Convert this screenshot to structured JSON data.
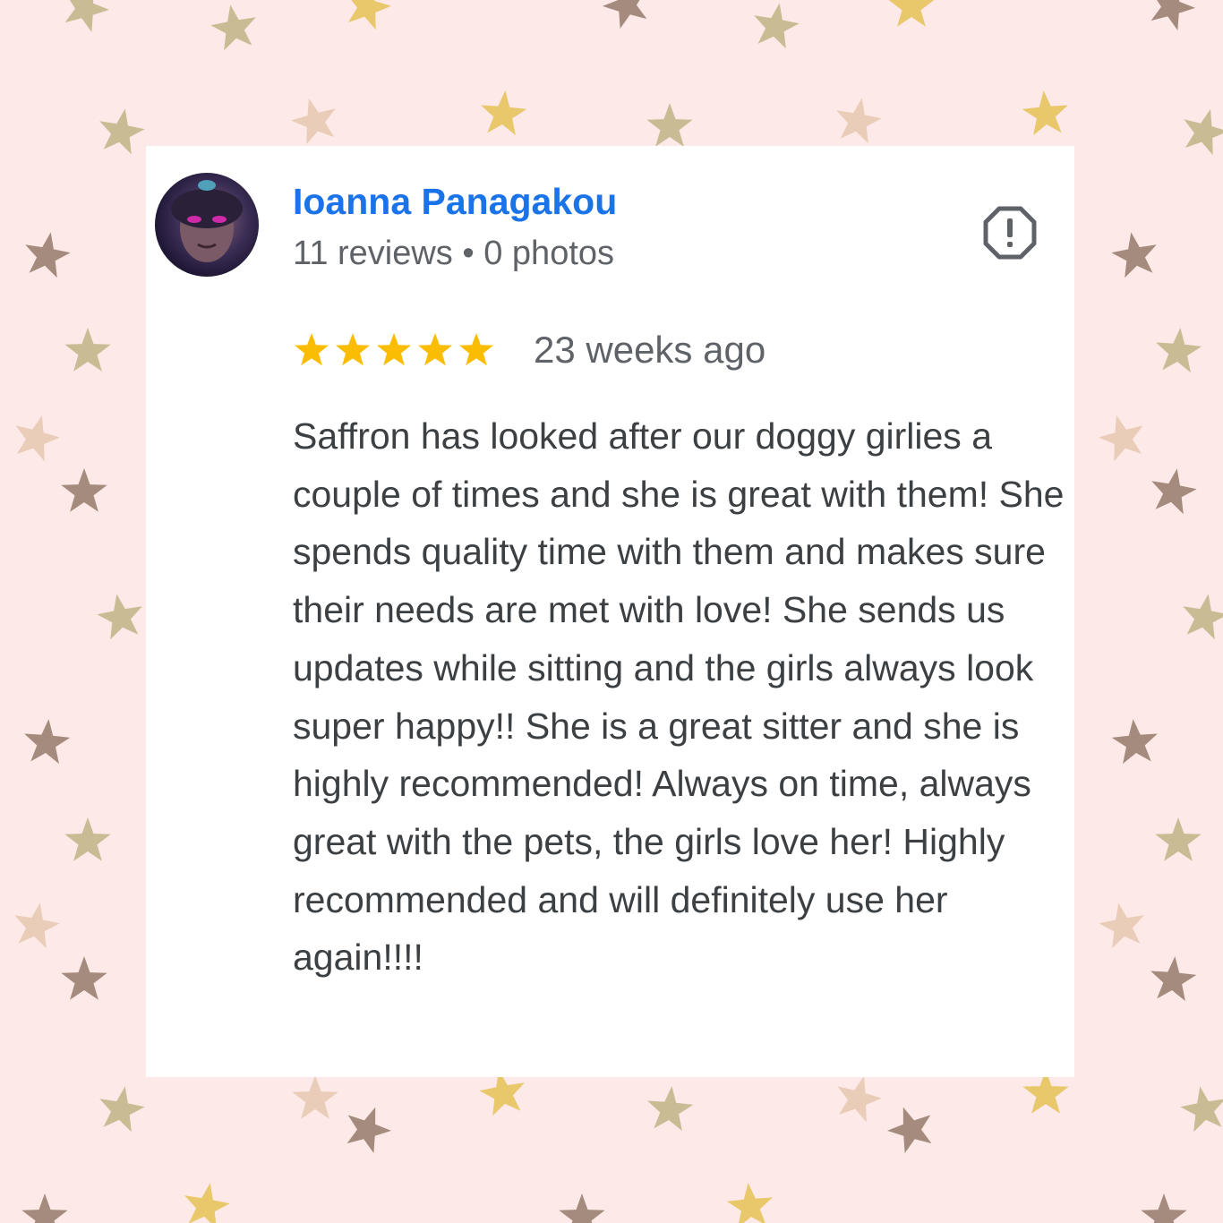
{
  "reviewer": {
    "name": "Ioanna Panagakou",
    "meta": "11 reviews • 0 photos"
  },
  "review": {
    "rating": 5,
    "max_rating": 5,
    "date": "23 weeks ago",
    "text": "Saffron has looked after our doggy girlies a couple of times and she is great with them! She spends quality time with them and makes sure their needs are met with love! She sends us updates while sitting and the girls always look super happy!! She is a great sitter and she is highly recommended! Always on time, always great with the pets, the girls love her! Highly recommended and will definitely use her again!!!!"
  },
  "icons": {
    "avatar": "reviewer-avatar",
    "report": "report-icon",
    "star": "star-icon"
  },
  "colors": {
    "background": "#fde9e7",
    "card": "#ffffff",
    "name": "#1a73e8",
    "meta": "#5f6368",
    "text": "#3c4043",
    "star": "#fbbc04",
    "report_icon": "#5f6368",
    "bg_star_palette": [
      "#c9bc94",
      "#a48b7d",
      "#e9cdb8",
      "#e8c86a"
    ]
  }
}
